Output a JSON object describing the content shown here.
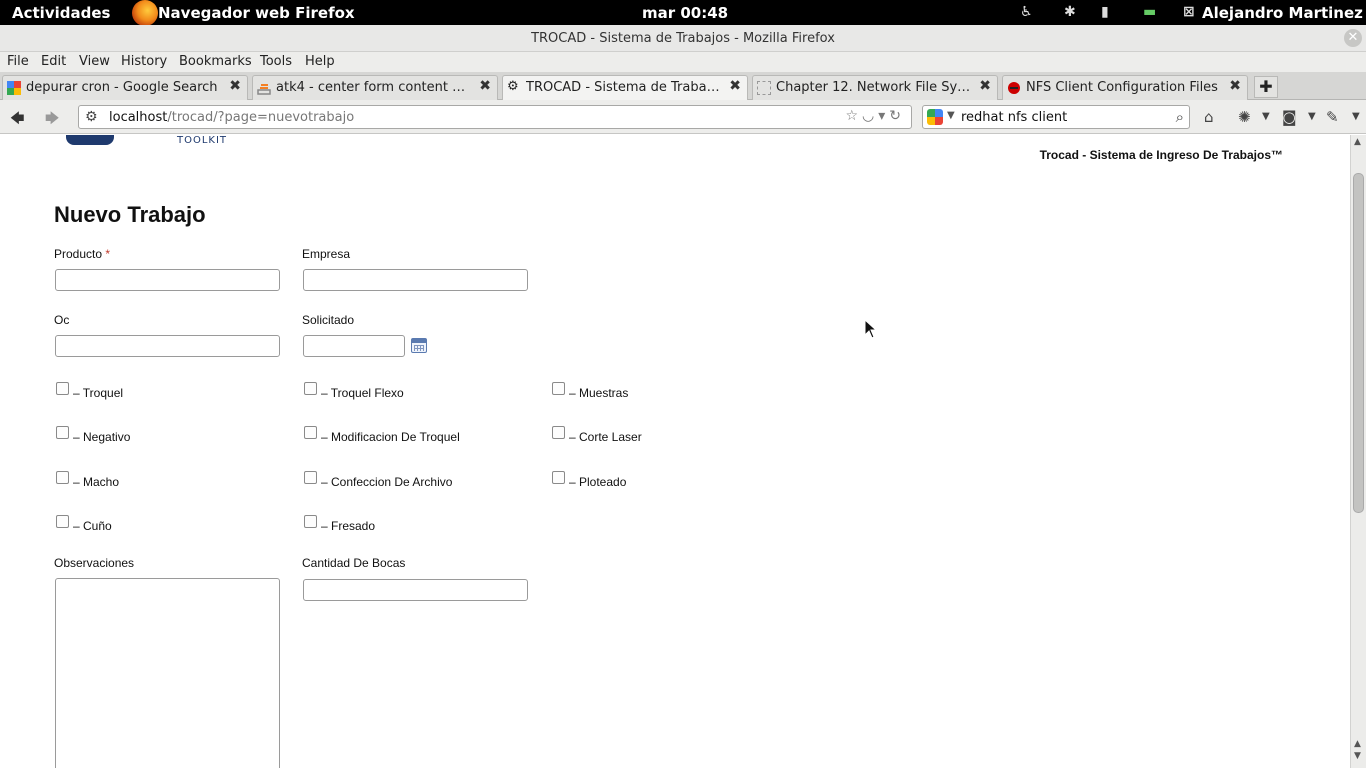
{
  "topbar": {
    "activities": "Actividades",
    "app_name": "Navegador web Firefox",
    "clock": "mar 00:48",
    "user": "Alejandro Martinez"
  },
  "window": {
    "title": "TROCAD - Sistema de Trabajos - Mozilla Firefox"
  },
  "menubar": [
    "File",
    "Edit",
    "View",
    "History",
    "Bookmarks",
    "Tools",
    "Help"
  ],
  "tabs": [
    {
      "label": "depurar cron - Google Search",
      "icon": "google-icon"
    },
    {
      "label": "atk4 - center form content mod…",
      "icon": "stackoverflow-icon"
    },
    {
      "label": "TROCAD - Sistema de Trabajos",
      "icon": "gear-icon",
      "active": true
    },
    {
      "label": "Chapter 12.  Network File Syste…",
      "icon": "page-icon"
    },
    {
      "label": "NFS Client Configuration Files",
      "icon": "redhat-icon"
    }
  ],
  "navbar": {
    "url_host": "localhost",
    "url_path": "/trocad/?page=nuevotrabajo",
    "search_query": "redhat nfs client"
  },
  "page": {
    "logo_text": "TOOLKIT",
    "site_title": "Trocad - Sistema de Ingreso De Trabajos™",
    "heading": "Nuevo Trabajo",
    "fields": {
      "producto": "Producto",
      "required_mark": "*",
      "empresa": "Empresa",
      "oc": "Oc",
      "solicitado": "Solicitado",
      "observaciones": "Observaciones",
      "cantidad_bocas": "Cantidad De Bocas"
    },
    "checkboxes": [
      "– Troquel",
      "– Troquel Flexo",
      "– Muestras",
      "– Negativo",
      "– Modificacion De Troquel",
      "– Corte Laser",
      "– Macho",
      "– Confeccion De Archivo",
      "– Ploteado",
      "– Cuño",
      "– Fresado"
    ]
  }
}
